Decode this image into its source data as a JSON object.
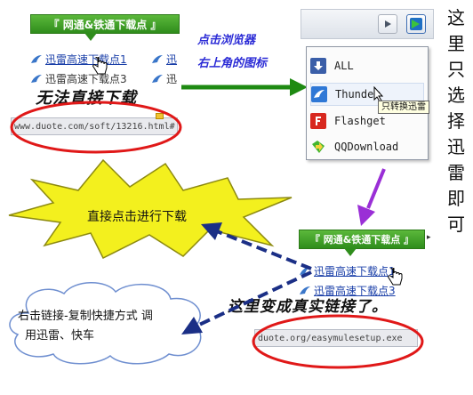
{
  "top_left": {
    "banner": "『 网通&铁通下载点 』",
    "rows": [
      {
        "label": "迅雷高速下载点1",
        "partial": "迅"
      },
      {
        "label": "迅雷高速下载点3",
        "partial": "迅"
      }
    ],
    "overlay_text": "无法直接下载",
    "url": "www.duote.com/soft/13216.html#"
  },
  "instruction_blue": [
    "点击浏览器",
    "右上角的图标"
  ],
  "browser_menu": {
    "items": [
      {
        "label": "ALL",
        "icon": "all-download-icon"
      },
      {
        "label": "Thunder",
        "icon": "thunder-icon"
      },
      {
        "label": "Flashget",
        "icon": "flashget-icon"
      },
      {
        "label": "QQDownload",
        "icon": "qqdownload-icon"
      }
    ],
    "tooltip": "只转换迅雷"
  },
  "vertical_note": [
    "这",
    "里",
    "只",
    "选",
    "择",
    "迅",
    "雷",
    "即",
    "可"
  ],
  "starburst_text": "直接点击进行下载",
  "cloud_text": [
    "右击链接-复制快捷方式 调",
    "用迅雷、快车"
  ],
  "bottom_right": {
    "banner": "『 网通&铁通下载点 』",
    "rows": [
      {
        "label": "迅雷高速下载点1"
      },
      {
        "label": "迅雷高速下载点3"
      }
    ],
    "overlay_text": "这里变成真实链接了。",
    "url": "duote.org/easymulesetup.exe"
  },
  "colors": {
    "banner_green": "#2f8d1c",
    "arrow_green": "#1e8a12",
    "arrow_purple": "#9a2fd6",
    "arrow_dashed": "#1b2f86",
    "ellipse_red": "#e01818",
    "star_fill": "#f3f01e",
    "cloud_border": "#6f8fd0"
  }
}
